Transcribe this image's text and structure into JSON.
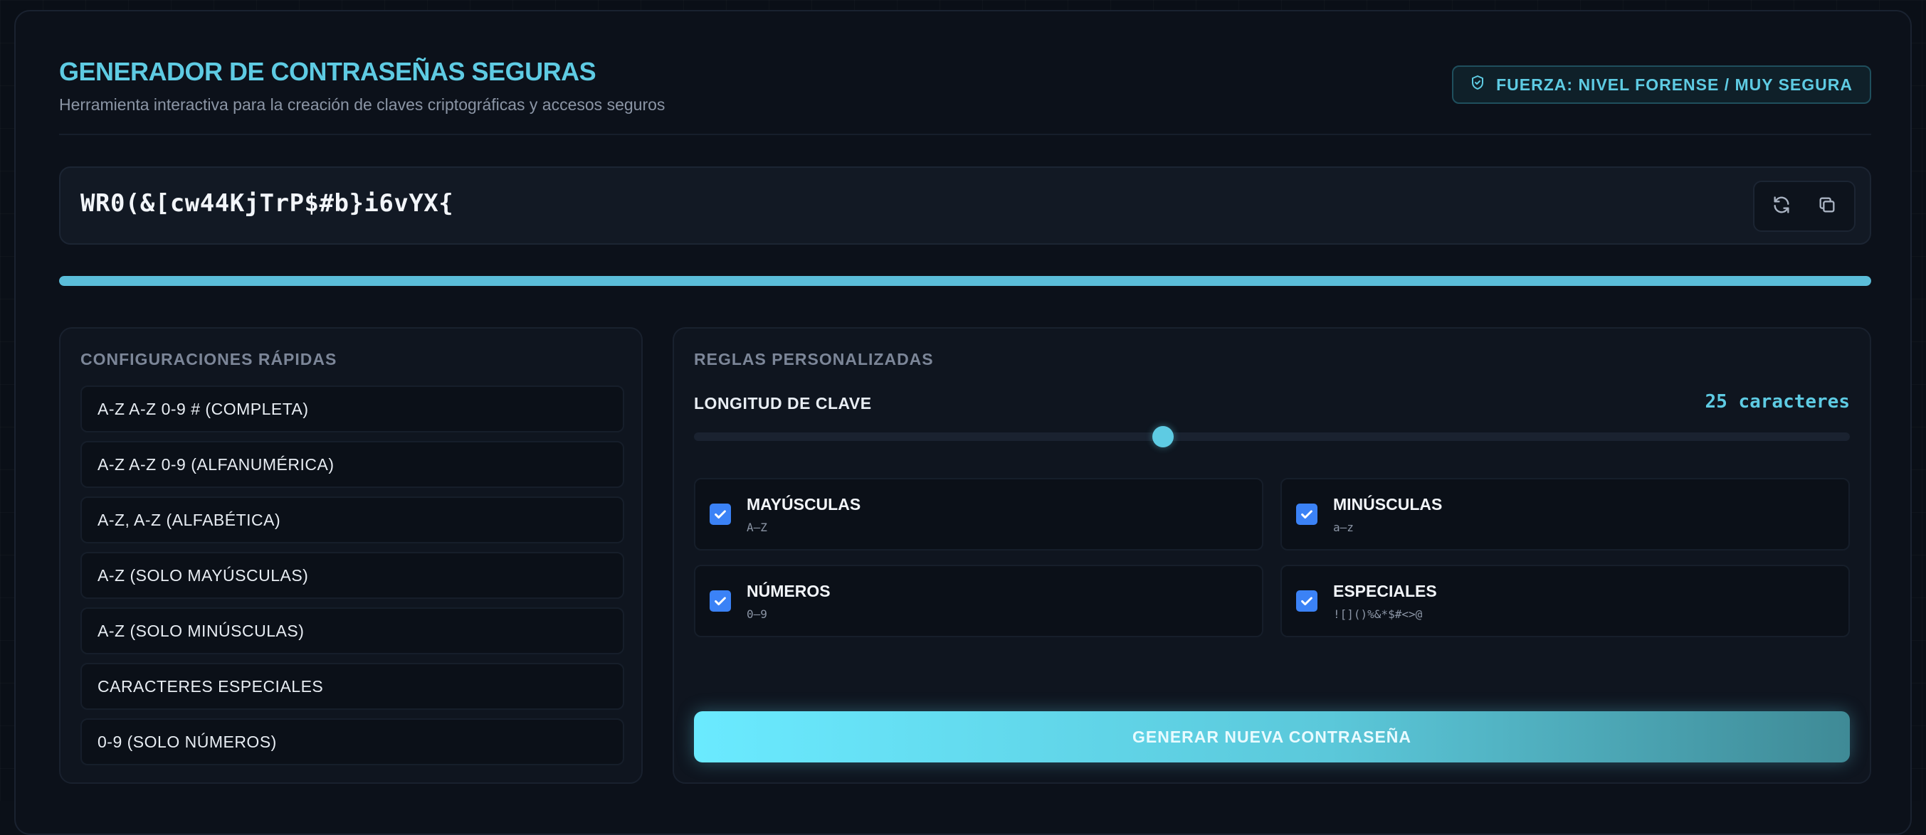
{
  "header": {
    "title": "GENERADOR DE CONTRASEÑAS SEGURAS",
    "subtitle": "Herramienta interactiva para la creación de claves criptográficas y accesos seguros",
    "badge": "FUERZA: NIVEL FORENSE / MUY SEGURA",
    "badge_icon": "shield-check-icon"
  },
  "password": {
    "value": "WR0(&[cw44KjTrP$#b}i6vYX{",
    "refresh_icon": "refresh-icon",
    "copy_icon": "copy-icon"
  },
  "strength": {
    "level": 1.0,
    "color": "#5bbdd9"
  },
  "quick": {
    "title": "CONFIGURACIONES RÁPIDAS",
    "items": [
      "A-Z A-Z 0-9 # (COMPLETA)",
      "A-Z A-Z 0-9 (ALFANUMÉRICA)",
      "A-Z, A-Z (ALFABÉTICA)",
      "A-Z (SOLO MAYÚSCULAS)",
      "A-Z (SOLO MINÚSCULAS)",
      "CARACTERES ESPECIALES",
      "0-9 (SOLO NÚMEROS)"
    ]
  },
  "custom": {
    "title": "REGLAS PERSONALIZADAS",
    "length_label": "LONGITUD DE CLAVE",
    "length_value": "25 caracteres",
    "slider_level": 0.406,
    "rules": [
      {
        "name": "MAYÚSCULAS",
        "sample": "A–Z",
        "checked": true
      },
      {
        "name": "MINÚSCULAS",
        "sample": "a–z",
        "checked": true
      },
      {
        "name": "NÚMEROS",
        "sample": "0–9",
        "checked": true
      },
      {
        "name": "ESPECIALES",
        "sample": "![]()%&*$#<>@",
        "checked": true
      }
    ],
    "generate_label": "GENERAR NUEVA CONTRASEÑA"
  },
  "colors": {
    "accent": "#5ecbe3",
    "checkbox": "#3b82f6",
    "background": "#0a0f17"
  }
}
